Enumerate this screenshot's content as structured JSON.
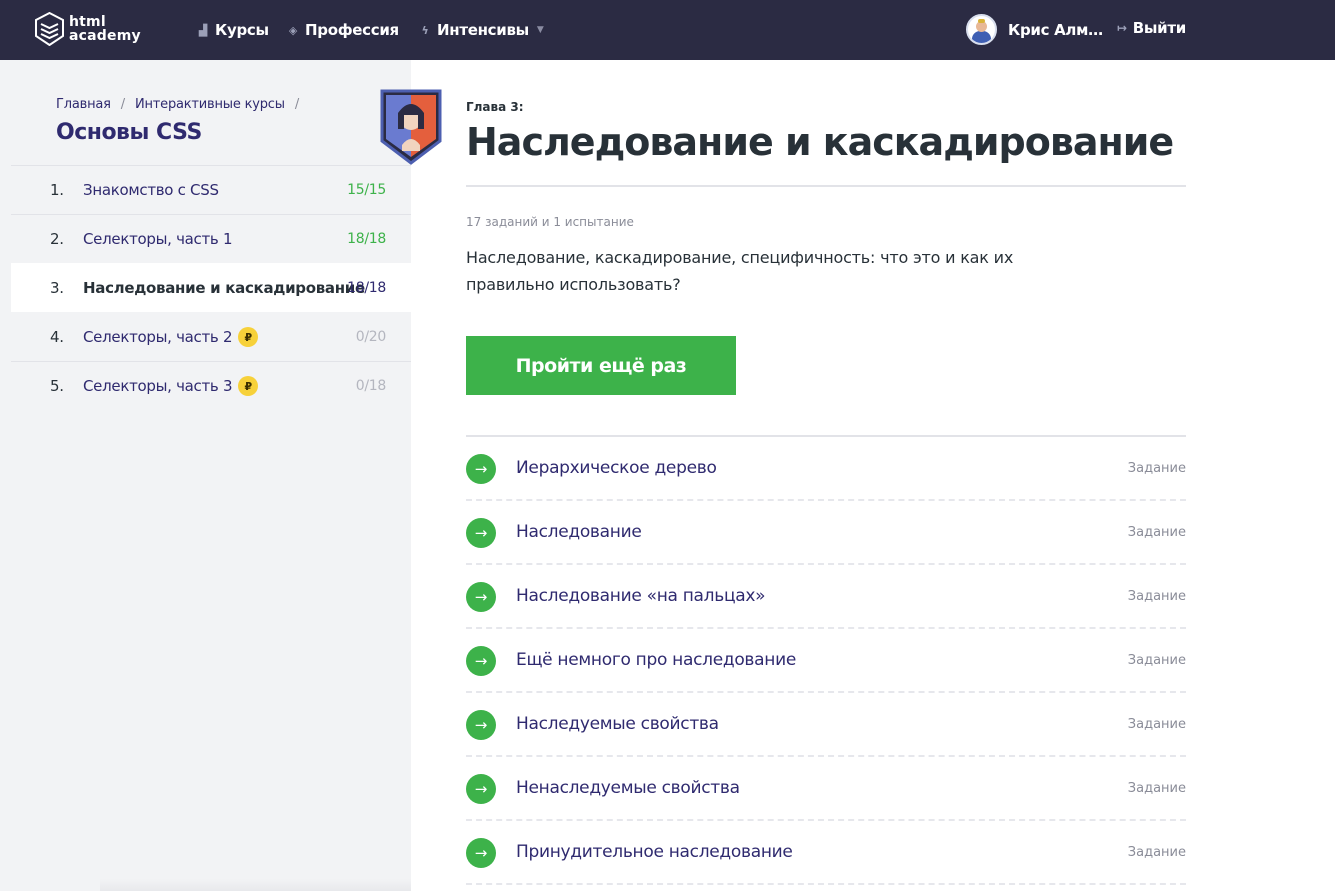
{
  "header": {
    "logo_line1": "html",
    "logo_line2": "academy",
    "nav": [
      {
        "label": "Курсы",
        "icon": "bars-icon"
      },
      {
        "label": "Профессия",
        "icon": "graduation-cap-icon"
      },
      {
        "label": "Интенсивы",
        "icon": "lightning-icon"
      }
    ],
    "user_name": "Крис Алм…",
    "logout_label": "Выйти"
  },
  "sidebar": {
    "breadcrumbs": [
      "Главная",
      "Интерактивные курсы"
    ],
    "breadcrumb_separator": "/",
    "course_title": "Основы CSS",
    "chapters": [
      {
        "num": "1.",
        "title": "Знакомство с CSS",
        "progress": "15/15",
        "status": "done",
        "paid": false
      },
      {
        "num": "2.",
        "title": "Селекторы, часть 1",
        "progress": "18/18",
        "status": "done",
        "paid": false
      },
      {
        "num": "3.",
        "title": "Наследование и каскадирование",
        "progress": "18/18",
        "status": "current",
        "paid": false
      },
      {
        "num": "4.",
        "title": "Селекторы, часть 2",
        "progress": "0/20",
        "status": "none",
        "paid": true
      },
      {
        "num": "5.",
        "title": "Селекторы, часть 3",
        "progress": "0/18",
        "status": "none",
        "paid": true
      }
    ],
    "rub_symbol": "₽"
  },
  "main": {
    "chapter_label": "Глава 3:",
    "title": "Наследование и каскадирование",
    "meta": "17 заданий и 1 испытание",
    "description": "Наследование, каскадирование, специфичность: что это и как их правильно использовать?",
    "cta_label": "Пройти ещё раз",
    "tasks": [
      {
        "title": "Иерархическое дерево",
        "type": "Задание"
      },
      {
        "title": "Наследование",
        "type": "Задание"
      },
      {
        "title": "Наследование «на пальцах»",
        "type": "Задание"
      },
      {
        "title": "Ещё немного про наследование",
        "type": "Задание"
      },
      {
        "title": "Наследуемые свойства",
        "type": "Задание"
      },
      {
        "title": "Ненаследуемые свойства",
        "type": "Задание"
      },
      {
        "title": "Принудительное наследование",
        "type": "Задание"
      }
    ],
    "task_arrow": "→"
  },
  "colors": {
    "header_bg": "#2b2b43",
    "accent_green": "#3db24a",
    "link_purple": "#2f2a6f",
    "sidebar_bg": "#f2f3f5",
    "rub_yellow": "#f7d13a"
  }
}
